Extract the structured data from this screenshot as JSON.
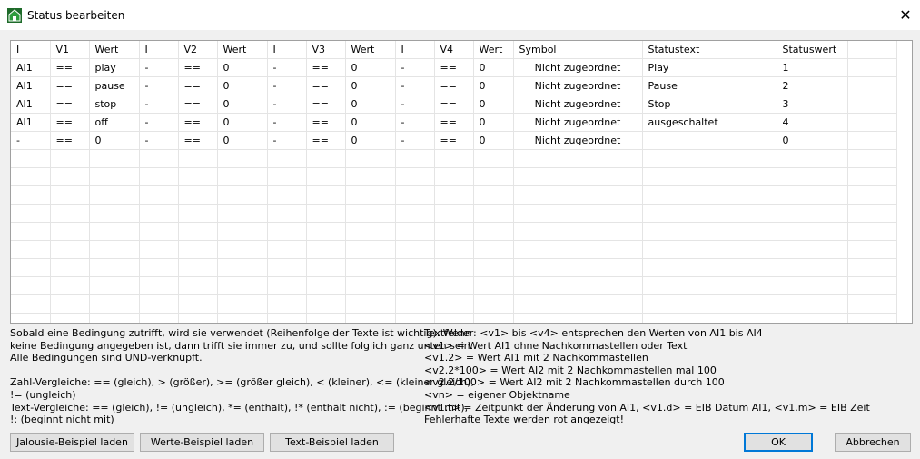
{
  "window": {
    "title": "Status bearbeiten",
    "close_glyph": "✕"
  },
  "table": {
    "headers": [
      "I",
      "V1",
      "Wert",
      "I",
      "V2",
      "Wert",
      "I",
      "V3",
      "Wert",
      "I",
      "V4",
      "Wert",
      "Symbol",
      "Statustext",
      "Statuswert",
      ""
    ],
    "rows": [
      [
        "AI1",
        "==",
        "play",
        "-",
        "==",
        "0",
        "-",
        "==",
        "0",
        "-",
        "==",
        "0",
        "Nicht zugeordnet",
        "Play",
        "1",
        ""
      ],
      [
        "AI1",
        "==",
        "pause",
        "-",
        "==",
        "0",
        "-",
        "==",
        "0",
        "-",
        "==",
        "0",
        "Nicht zugeordnet",
        "Pause",
        "2",
        ""
      ],
      [
        "AI1",
        "==",
        "stop",
        "-",
        "==",
        "0",
        "-",
        "==",
        "0",
        "-",
        "==",
        "0",
        "Nicht zugeordnet",
        "Stop",
        "3",
        ""
      ],
      [
        "AI1",
        "==",
        "off",
        "-",
        "==",
        "0",
        "-",
        "==",
        "0",
        "-",
        "==",
        "0",
        "Nicht zugeordnet",
        "ausgeschaltet",
        "4",
        ""
      ],
      [
        "-",
        "==",
        "0",
        "-",
        "==",
        "0",
        "-",
        "==",
        "0",
        "-",
        "==",
        "0",
        "Nicht zugeordnet",
        "",
        "0",
        ""
      ],
      [
        "",
        "",
        "",
        "",
        "",
        "",
        "",
        "",
        "",
        "",
        "",
        "",
        "",
        "",
        "",
        ""
      ],
      [
        "",
        "",
        "",
        "",
        "",
        "",
        "",
        "",
        "",
        "",
        "",
        "",
        "",
        "",
        "",
        ""
      ],
      [
        "",
        "",
        "",
        "",
        "",
        "",
        "",
        "",
        "",
        "",
        "",
        "",
        "",
        "",
        "",
        ""
      ],
      [
        "",
        "",
        "",
        "",
        "",
        "",
        "",
        "",
        "",
        "",
        "",
        "",
        "",
        "",
        "",
        ""
      ],
      [
        "",
        "",
        "",
        "",
        "",
        "",
        "",
        "",
        "",
        "",
        "",
        "",
        "",
        "",
        "",
        ""
      ],
      [
        "",
        "",
        "",
        "",
        "",
        "",
        "",
        "",
        "",
        "",
        "",
        "",
        "",
        "",
        "",
        ""
      ],
      [
        "",
        "",
        "",
        "",
        "",
        "",
        "",
        "",
        "",
        "",
        "",
        "",
        "",
        "",
        "",
        ""
      ],
      [
        "",
        "",
        "",
        "",
        "",
        "",
        "",
        "",
        "",
        "",
        "",
        "",
        "",
        "",
        "",
        ""
      ],
      [
        "",
        "",
        "",
        "",
        "",
        "",
        "",
        "",
        "",
        "",
        "",
        "",
        "",
        "",
        "",
        ""
      ],
      [
        "",
        "",
        "",
        "",
        "",
        "",
        "",
        "",
        "",
        "",
        "",
        "",
        "",
        "",
        "",
        ""
      ]
    ]
  },
  "help_left": "Sobald eine Bedingung zutrifft, wird sie verwendet (Reihenfolge der Texte ist wichtig). Wenn\nkeine Bedingung angegeben ist, dann trifft sie immer zu, und sollte folglich ganz unten sein.\nAlle Bedingungen sind UND-verknüpft.\n\nZahl-Vergleiche: == (gleich), > (größer), >= (größer gleich), < (kleiner), <= (kleiner gleich),\n!= (ungleich)\nText-Vergleiche: == (gleich), != (ungleich), *= (enthält), !* (enthält nicht), := (beginnt mit),\n!: (beginnt nicht mit)",
  "help_right": "Textfelder: <v1> bis <v4> entsprechen den Werten von AI1 bis AI4\n<v1> = Wert AI1 ohne Nachkommastellen oder Text\n<v1.2> = Wert AI1 mit 2 Nachkommastellen\n<v2.2*100> = Wert AI2 mit 2 Nachkommastellen mal 100\n<v2.2/100> = Wert AI2 mit 2 Nachkommastellen durch 100\n<vn> = eigener Objektname\n<v1.t> = Zeitpunkt der Änderung von AI1, <v1.d> = EIB Datum AI1, <v1.m> = EIB Zeit\nFehlerhafte Texte werden rot angezeigt!",
  "buttons": {
    "jalousie": "Jalousie-Beispiel laden",
    "werte": "Werte-Beispiel laden",
    "text": "Text-Beispiel laden",
    "ok": "OK",
    "cancel": "Abbrechen"
  }
}
